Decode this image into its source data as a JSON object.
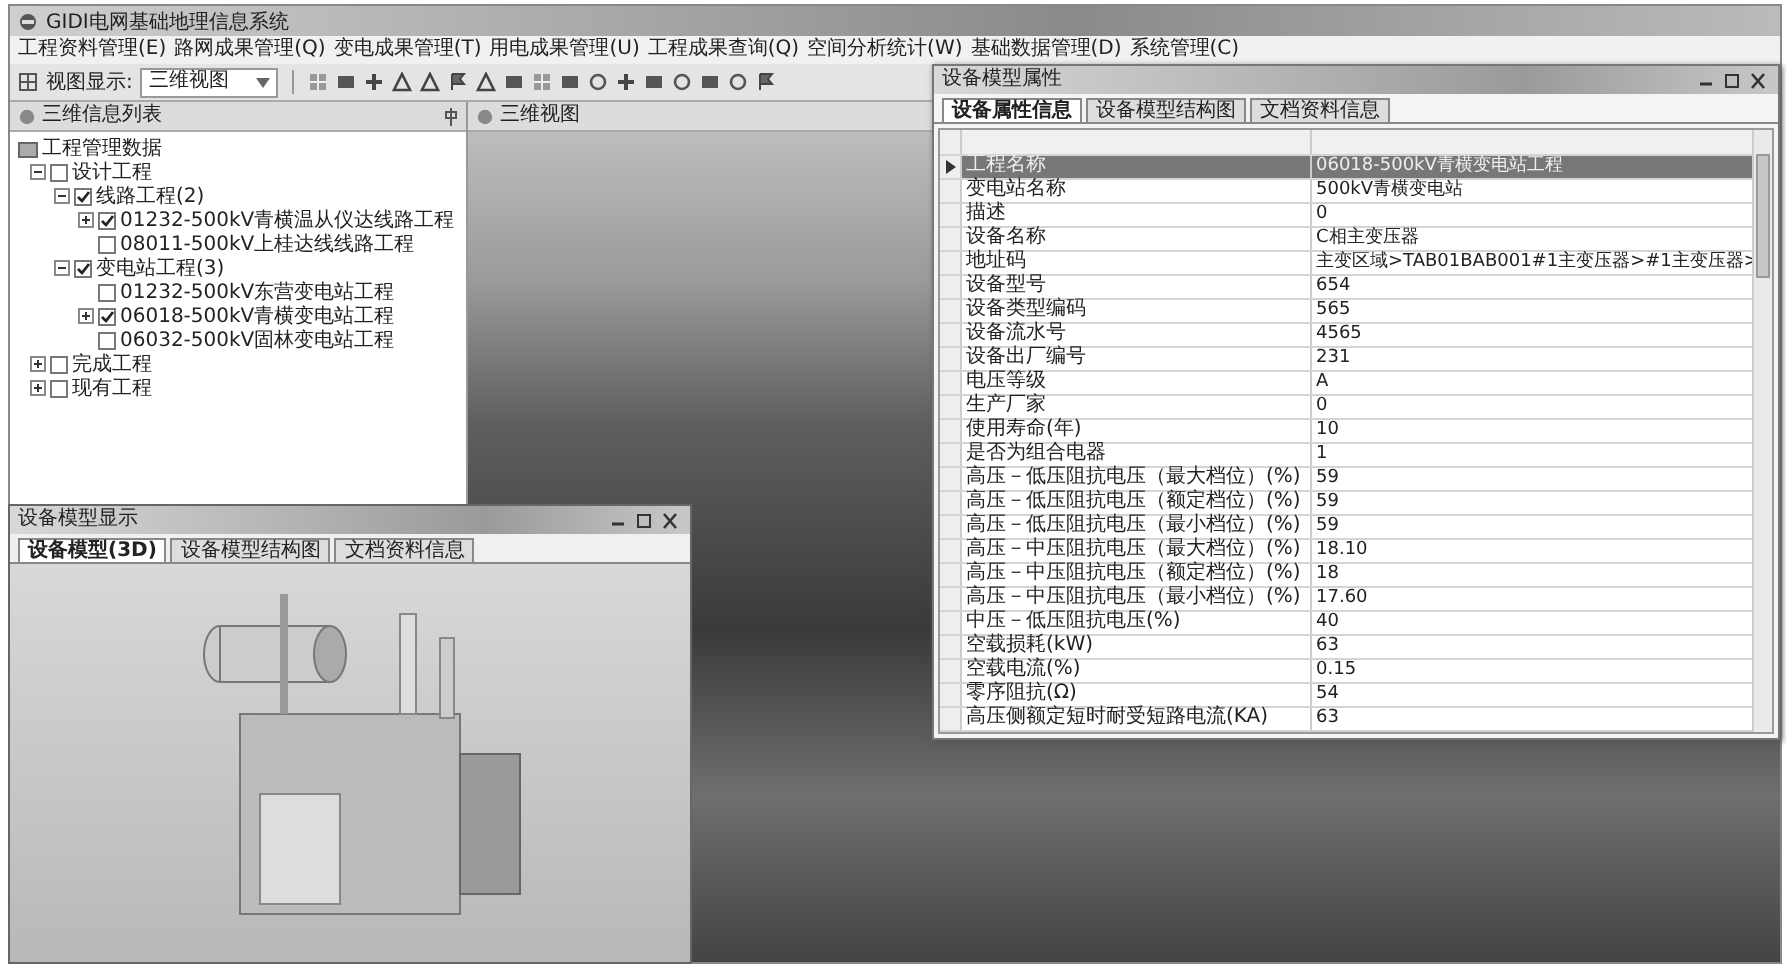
{
  "main_window": {
    "title": "GIDI电网基础地理信息系统",
    "menu": [
      "工程资料管理(E)",
      "路网成果管理(Q)",
      "变电成果管理(T)",
      "用电成果管理(U)",
      "工程成果查询(Q)",
      "空间分析统计(W)",
      "基础数据管理(D)",
      "系统管理(C)"
    ],
    "toolbar": {
      "view_label": "视图显示:",
      "view_value": "三维视图"
    },
    "tree_panel": {
      "title": "三维信息列表",
      "root": "工程管理数据",
      "items": [
        {
          "label": "设计工程",
          "checked": false,
          "expanded": true,
          "children": [
            {
              "label": "线路工程(2)",
              "checked": true,
              "expanded": true,
              "children": [
                {
                  "label": "01232-500kV青横温从仪达线路工程",
                  "checked": true,
                  "expanded": false
                },
                {
                  "label": "08011-500kV上桂达线线路工程",
                  "checked": false
                }
              ]
            },
            {
              "label": "变电站工程(3)",
              "checked": true,
              "expanded": true,
              "children": [
                {
                  "label": "01232-500kV东营变电站工程",
                  "checked": false
                },
                {
                  "label": "06018-500kV青横变电站工程",
                  "checked": true,
                  "expanded": false
                },
                {
                  "label": "06032-500kV固林变电站工程",
                  "checked": false
                }
              ]
            }
          ]
        },
        {
          "label": "完成工程",
          "checked": false,
          "expanded": false
        },
        {
          "label": "现有工程",
          "checked": false,
          "expanded": false
        }
      ]
    },
    "view_panel": {
      "title": "三维视图"
    }
  },
  "properties_window": {
    "title": "设备模型属性",
    "tabs": [
      {
        "label": "设备属性信息",
        "selected": true
      },
      {
        "label": "设备模型结构图",
        "selected": false
      },
      {
        "label": "文档资料信息",
        "selected": false
      }
    ],
    "rows": [
      {
        "name": "工程名称",
        "value": "06018-500kV青横变电站工程",
        "selected": true
      },
      {
        "name": "变电站名称",
        "value": "500kV青横变电站",
        "selected": false
      },
      {
        "name": "描述",
        "value": "0",
        "selected": false
      },
      {
        "name": "设备名称",
        "value": "C相主变压器",
        "selected": false
      },
      {
        "name": "地址码",
        "value": "主变区域>TAB01BAB001#1主变压器>#1主变压器>",
        "selected": false
      },
      {
        "name": "设备型号",
        "value": "654",
        "selected": false
      },
      {
        "name": "设备类型编码",
        "value": "565",
        "selected": false
      },
      {
        "name": "设备流水号",
        "value": "4565",
        "selected": false
      },
      {
        "name": "设备出厂编号",
        "value": "231",
        "selected": false
      },
      {
        "name": "电压等级",
        "value": "A",
        "selected": false
      },
      {
        "name": "生产厂家",
        "value": "0",
        "selected": false
      },
      {
        "name": "使用寿命(年)",
        "value": "10",
        "selected": false
      },
      {
        "name": "是否为组合电器",
        "value": "1",
        "selected": false
      },
      {
        "name": "高压－低压阻抗电压（最大档位）(%)",
        "value": "59",
        "selected": false
      },
      {
        "name": "高压－低压阻抗电压（额定档位）(%)",
        "value": "59",
        "selected": false
      },
      {
        "name": "高压－低压阻抗电压（最小档位）(%)",
        "value": "59",
        "selected": false
      },
      {
        "name": "高压－中压阻抗电压（最大档位）(%)",
        "value": "18.10",
        "selected": false
      },
      {
        "name": "高压－中压阻抗电压（额定档位）(%)",
        "value": "18",
        "selected": false
      },
      {
        "name": "高压－中压阻抗电压（最小档位）(%)",
        "value": "17.60",
        "selected": false
      },
      {
        "name": "中压－低压阻抗电压(%)",
        "value": "40",
        "selected": false
      },
      {
        "name": "空载损耗(kW)",
        "value": "63",
        "selected": false
      },
      {
        "name": "空载电流(%)",
        "value": "0.15",
        "selected": false
      },
      {
        "name": "零序阻抗(Ω)",
        "value": "54",
        "selected": false
      },
      {
        "name": "高压侧额定短时耐受短路电流(KA)",
        "value": "63",
        "selected": false
      }
    ]
  },
  "model_window": {
    "title": "设备模型显示",
    "tabs": [
      {
        "label": "设备模型(3D)",
        "selected": true
      },
      {
        "label": "设备模型结构图",
        "selected": false
      },
      {
        "label": "文档资料信息",
        "selected": false
      }
    ]
  }
}
